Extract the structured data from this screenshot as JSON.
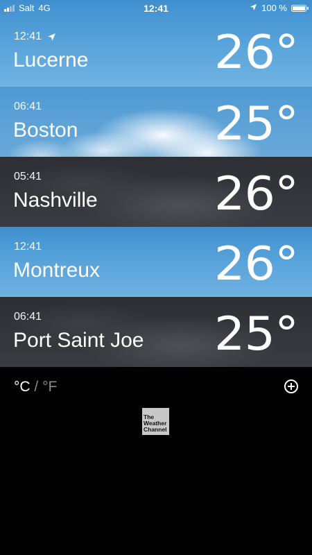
{
  "status_bar": {
    "carrier": "Salt",
    "network": "4G",
    "time": "12:41",
    "battery": "100 %",
    "battery_level": 1.0,
    "signal_bars": 2,
    "icons": [
      "signal-icon",
      "location-arrow-icon",
      "battery-icon"
    ]
  },
  "cities": [
    {
      "time": "12:41",
      "name": "Lucerne",
      "temp": "26°",
      "current_location": true,
      "background": "sunny"
    },
    {
      "time": "06:41",
      "name": "Boston",
      "temp": "25°",
      "current_location": false,
      "background": "sunny-cloud"
    },
    {
      "time": "05:41",
      "name": "Nashville",
      "temp": "26°",
      "current_location": false,
      "background": "night"
    },
    {
      "time": "12:41",
      "name": "Montreux",
      "temp": "26°",
      "current_location": false,
      "background": "sunny"
    },
    {
      "time": "06:41",
      "name": "Port Saint Joe",
      "temp": "25°",
      "current_location": false,
      "background": "night"
    }
  ],
  "footer": {
    "unit_c": "°C",
    "unit_separator": " / ",
    "unit_f": "°F",
    "add_icon": "plus-circle-icon",
    "logo_lines": [
      "The",
      "Weather",
      "Channel"
    ]
  },
  "colors": {
    "sunny": "#5ba5db",
    "night": "#34353b",
    "background": "#000000",
    "inactive_unit": "#8a8a8e"
  }
}
